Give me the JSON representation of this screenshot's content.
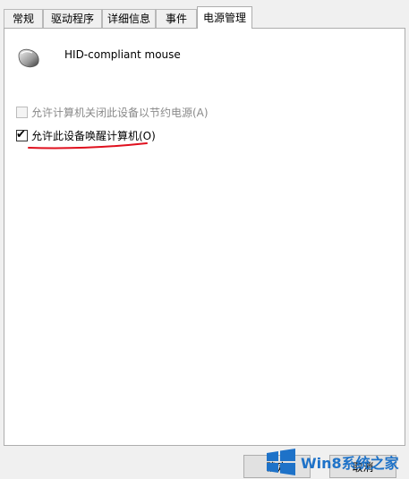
{
  "tabs": [
    {
      "label": "常规"
    },
    {
      "label": "驱动程序"
    },
    {
      "label": "详细信息"
    },
    {
      "label": "事件"
    },
    {
      "label": "电源管理"
    }
  ],
  "device": {
    "name": "HID-compliant mouse",
    "icon": "mouse-icon"
  },
  "options": [
    {
      "label": "允许计算机关闭此设备以节约电源(A)",
      "checked": false,
      "disabled": true
    },
    {
      "label": "允许此设备唤醒计算机(O)",
      "checked": true,
      "disabled": false
    }
  ],
  "buttons": {
    "ok": "确定",
    "cancel": "取消"
  },
  "watermark": {
    "text": "Win8系统之家"
  },
  "colors": {
    "annotation": "#e0101e",
    "watermark": "#1e72c8"
  }
}
